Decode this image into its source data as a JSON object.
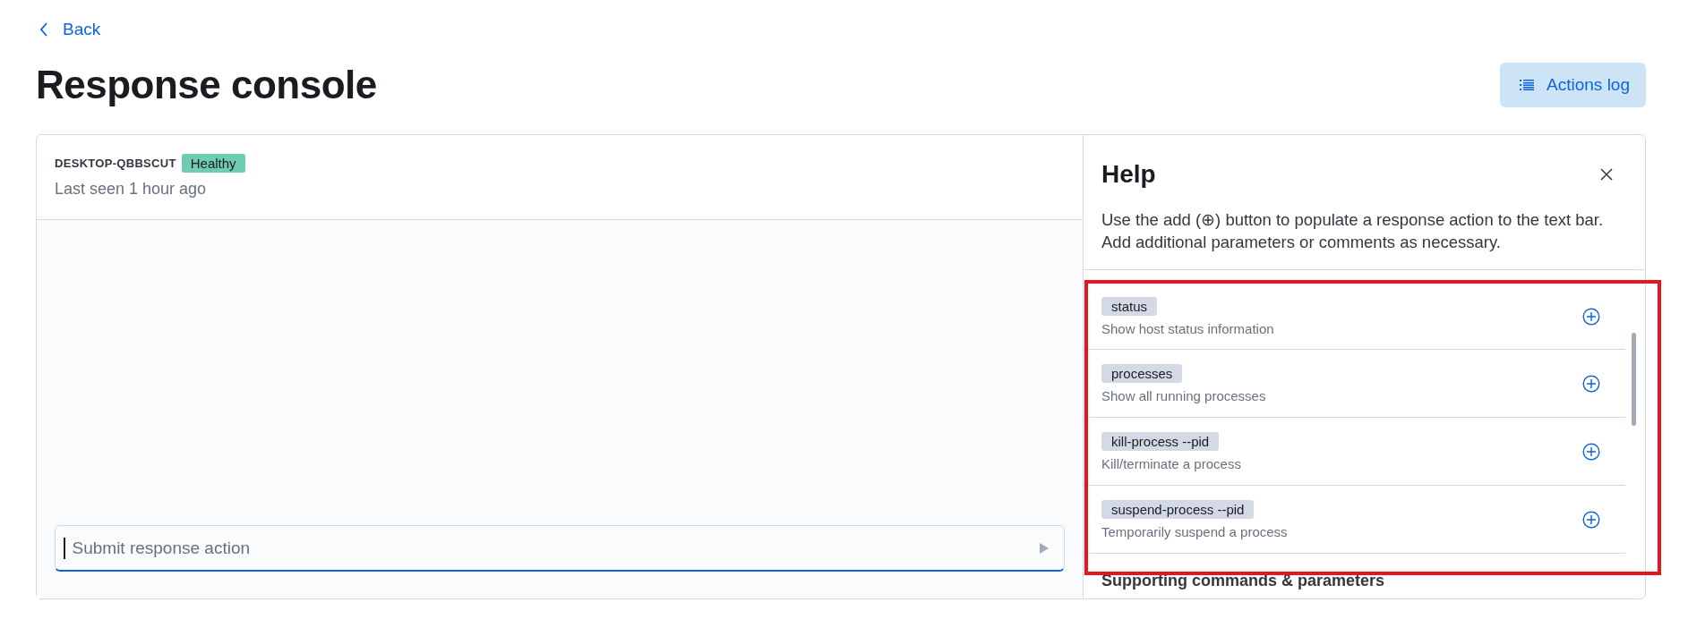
{
  "back_link": {
    "label": "Back"
  },
  "page_title": "Response console",
  "actions_log_button": {
    "label": "Actions log"
  },
  "host": {
    "name": "DESKTOP-QBBSCUT",
    "status": "Healthy",
    "color": "#6dccb1",
    "last_seen": "Last seen 1 hour ago"
  },
  "input": {
    "placeholder": "Submit response action"
  },
  "help": {
    "title": "Help",
    "description_parts": [
      "Use the add (",
      "⊕",
      ") button to populate a response action to the text bar. Add additional parameters or comments as necessary."
    ],
    "commands": [
      {
        "command": "status",
        "description": "Show host status information"
      },
      {
        "command": "processes",
        "description": "Show all running processes"
      },
      {
        "command": "kill-process --pid",
        "description": "Kill/terminate a process"
      },
      {
        "command": "suspend-process --pid",
        "description": "Temporarily suspend a process"
      }
    ],
    "section_heading": "Supporting commands & parameters"
  }
}
